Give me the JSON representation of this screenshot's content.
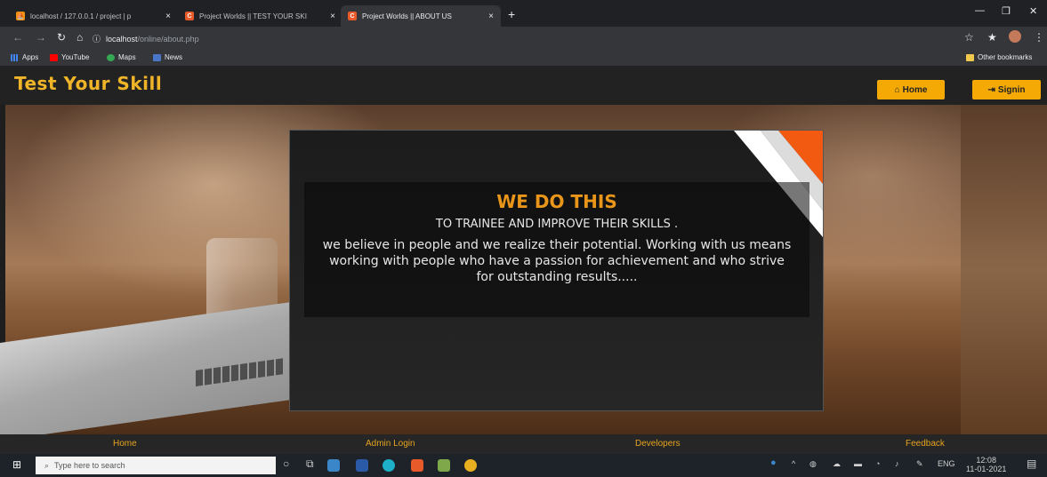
{
  "browser": {
    "tabs": [
      {
        "title": "localhost / 127.0.0.1 / project | p"
      },
      {
        "title": "Project Worlds || TEST YOUR SKI"
      },
      {
        "title": "Project Worlds || ABOUT US"
      }
    ],
    "address": {
      "host": "localhost",
      "path": "/online/about.php"
    },
    "bookmarks": [
      "Apps",
      "YouTube",
      "Maps",
      "News"
    ],
    "other_bookmarks": "Other bookmarks"
  },
  "site": {
    "brand": "Test Your Skill",
    "home_button": "Home",
    "signin_button": "Signin"
  },
  "card": {
    "heading": "WE DO THIS",
    "subheading": "TO TRAINEE AND IMPROVE THEIR SKILLS .",
    "body": "we believe in people and we realize their potential. Working with us means working with people who have a passion for achievement and who strive for outstanding results....."
  },
  "footer_nav": {
    "home": "Home",
    "admin_login": "Admin Login",
    "developers": "Developers",
    "feedback": "Feedback"
  },
  "taskbar": {
    "search_placeholder": "Type here to search",
    "language": "ENG",
    "time": "12:08",
    "date": "11-01-2021"
  },
  "colors": {
    "accent": "#f5a905",
    "heading": "#e8951a",
    "link": "#e6a31f"
  }
}
